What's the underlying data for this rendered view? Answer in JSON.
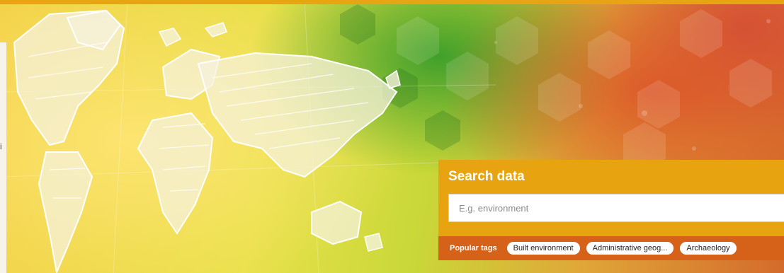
{
  "search": {
    "title": "Search data",
    "placeholder": "E.g. environment"
  },
  "popular_tags": {
    "label": "Popular tags",
    "tags": [
      "Built environment",
      "Administrative geog...",
      "Archaeology"
    ]
  },
  "side_fragment": "i",
  "colors": {
    "search_header": "#e8a311",
    "tags_bar": "#d6621a",
    "top_strip": "#e8a412"
  }
}
